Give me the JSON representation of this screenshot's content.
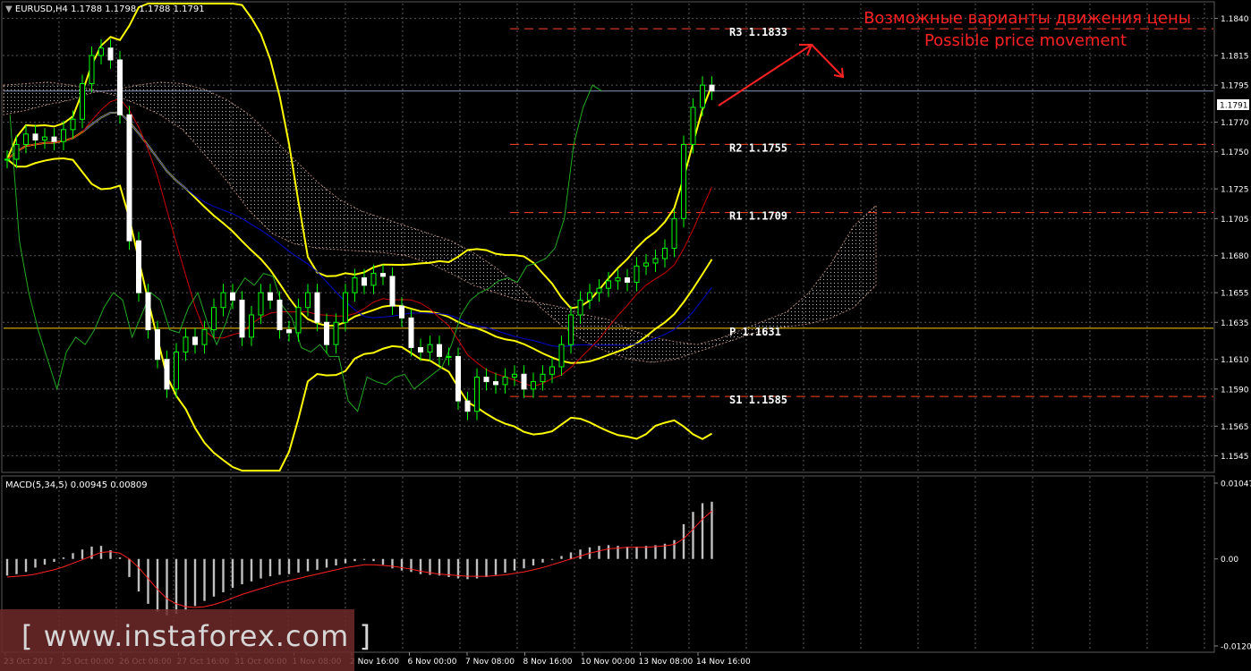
{
  "header": {
    "symbol": "EURUSD,H4",
    "ohlc": "1.1788 1.1798 1.1788 1.1791"
  },
  "annotation": {
    "line1": "Возможные варианты движения цены",
    "line2": "Possible price movement"
  },
  "watermark": "[ www.instaforex.com ]",
  "colors": {
    "background": "#000000",
    "grid": "#5a5a5a",
    "candle": "#00ff00",
    "bollinger": "#ffff00",
    "kijun": "#0000cc",
    "tenkan": "#cc0000",
    "chikou": "#22aa22",
    "pivot_resistance": "#ff4422",
    "pivot": "#ffcc00",
    "annotation": "#ff2222",
    "macd_hist": "#c0c0c0",
    "macd_signal": "#ff2222"
  },
  "chart_data": [
    {
      "type": "candlestick",
      "title": "EURUSD,H4",
      "ylim": [
        1.1535,
        1.185
      ],
      "y_ticks": [
        "1.1840",
        "1.1815",
        "1.1795",
        "1.1770",
        "1.1750",
        "1.1725",
        "1.1705",
        "1.1680",
        "1.1655",
        "1.1635",
        "1.1610",
        "1.1590",
        "1.1565",
        "1.1545"
      ],
      "x_ticks": [
        "23 Oct 2017",
        "25 Oct 00:00",
        "26 Oct 08:00",
        "27 Oct 16:00",
        "31 Oct 00:00",
        "1 Nov 08:00",
        "2 Nov 16:00",
        "6 Nov 00:00",
        "7 Nov 08:00",
        "8 Nov 16:00",
        "10 Nov 00:00",
        "13 Nov 08:00",
        "14 Nov 16:00"
      ],
      "current_price": "1.1791",
      "levels": [
        {
          "label": "R3",
          "value": "1.1833"
        },
        {
          "label": "R2",
          "value": "1.1755"
        },
        {
          "label": "R1",
          "value": "1.1709"
        },
        {
          "label": "P",
          "value": "1.1631"
        },
        {
          "label": "S1",
          "value": "1.1585"
        }
      ],
      "close": [
        1.1745,
        1.1755,
        1.1762,
        1.1758,
        1.176,
        1.1757,
        1.1765,
        1.1772,
        1.1796,
        1.1815,
        1.182,
        1.1812,
        1.1775,
        1.169,
        1.1655,
        1.163,
        1.161,
        1.159,
        1.1615,
        1.1625,
        1.162,
        1.163,
        1.1645,
        1.1655,
        1.165,
        1.1625,
        1.164,
        1.1655,
        1.165,
        1.163,
        1.1628,
        1.1645,
        1.1655,
        1.1635,
        1.162,
        1.1635,
        1.1655,
        1.1665,
        1.166,
        1.1668,
        1.1666,
        1.1646,
        1.1638,
        1.1618,
        1.1615,
        1.162,
        1.1612,
        1.1612,
        1.1582,
        1.1575,
        1.1598,
        1.1595,
        1.1593,
        1.1598,
        1.16,
        1.159,
        1.1595,
        1.16,
        1.1605,
        1.162,
        1.164,
        1.165,
        1.1655,
        1.1658,
        1.1663,
        1.1665,
        1.1662,
        1.1673,
        1.1675,
        1.1678,
        1.1685,
        1.1705,
        1.1755,
        1.178,
        1.1795,
        1.1791
      ]
    },
    {
      "type": "bar",
      "title": "MACD(5,34,5) 0.00945 0.00809",
      "ylim": [
        -0.01202,
        0.01047
      ],
      "y_ticks": [
        "0.01047",
        "0.00",
        "-0.01202"
      ],
      "histogram": [
        -0.0023,
        -0.0021,
        -0.0018,
        -0.0012,
        -0.0008,
        -0.0004,
        0.0002,
        0.0008,
        0.0013,
        0.0017,
        0.0018,
        0.0012,
        0.0002,
        -0.0025,
        -0.0045,
        -0.0062,
        -0.0073,
        -0.0078,
        -0.0076,
        -0.0071,
        -0.0065,
        -0.0058,
        -0.0052,
        -0.0046,
        -0.004,
        -0.0035,
        -0.0031,
        -0.0027,
        -0.0024,
        -0.0022,
        -0.0021,
        -0.0019,
        -0.0017,
        -0.0015,
        -0.0012,
        -0.0009,
        -0.0006,
        -0.0003,
        0.0,
        -0.0003,
        -0.0008,
        -0.0013,
        -0.0016,
        -0.0018,
        -0.0021,
        -0.0022,
        -0.0023,
        -0.0025,
        -0.0027,
        -0.0028,
        -0.0027,
        -0.0025,
        -0.0022,
        -0.0019,
        -0.0016,
        -0.0013,
        -0.0009,
        -0.0005,
        -0.0001,
        0.0004,
        0.0009,
        0.0013,
        0.0016,
        0.0018,
        0.0019,
        0.0018,
        0.0017,
        0.0017,
        0.0018,
        0.0019,
        0.0021,
        0.0026,
        0.0048,
        0.0065,
        0.0077,
        0.0079
      ],
      "signal": [
        -0.0025,
        -0.0024,
        -0.0023,
        -0.0021,
        -0.0018,
        -0.0015,
        -0.0011,
        -0.0006,
        -0.0001,
        0.0004,
        0.0009,
        0.001,
        0.0008,
        0.0,
        -0.0012,
        -0.0027,
        -0.0042,
        -0.0055,
        -0.0062,
        -0.0066,
        -0.0067,
        -0.0066,
        -0.0063,
        -0.0059,
        -0.0054,
        -0.0049,
        -0.0045,
        -0.0041,
        -0.0037,
        -0.0033,
        -0.003,
        -0.0027,
        -0.0024,
        -0.0021,
        -0.0018,
        -0.0015,
        -0.0012,
        -0.001,
        -0.0008,
        -0.0008,
        -0.0009,
        -0.001,
        -0.0012,
        -0.0014,
        -0.0017,
        -0.0019,
        -0.0021,
        -0.0022,
        -0.0023,
        -0.0024,
        -0.0024,
        -0.0024,
        -0.0023,
        -0.0022,
        -0.002,
        -0.0018,
        -0.0015,
        -0.0012,
        -0.0008,
        -0.0004,
        0.0,
        0.0004,
        0.0008,
        0.0011,
        0.0014,
        0.0015,
        0.0016,
        0.0016,
        0.0016,
        0.0017,
        0.0018,
        0.002,
        0.0028,
        0.0041,
        0.0055,
        0.0066
      ]
    }
  ]
}
